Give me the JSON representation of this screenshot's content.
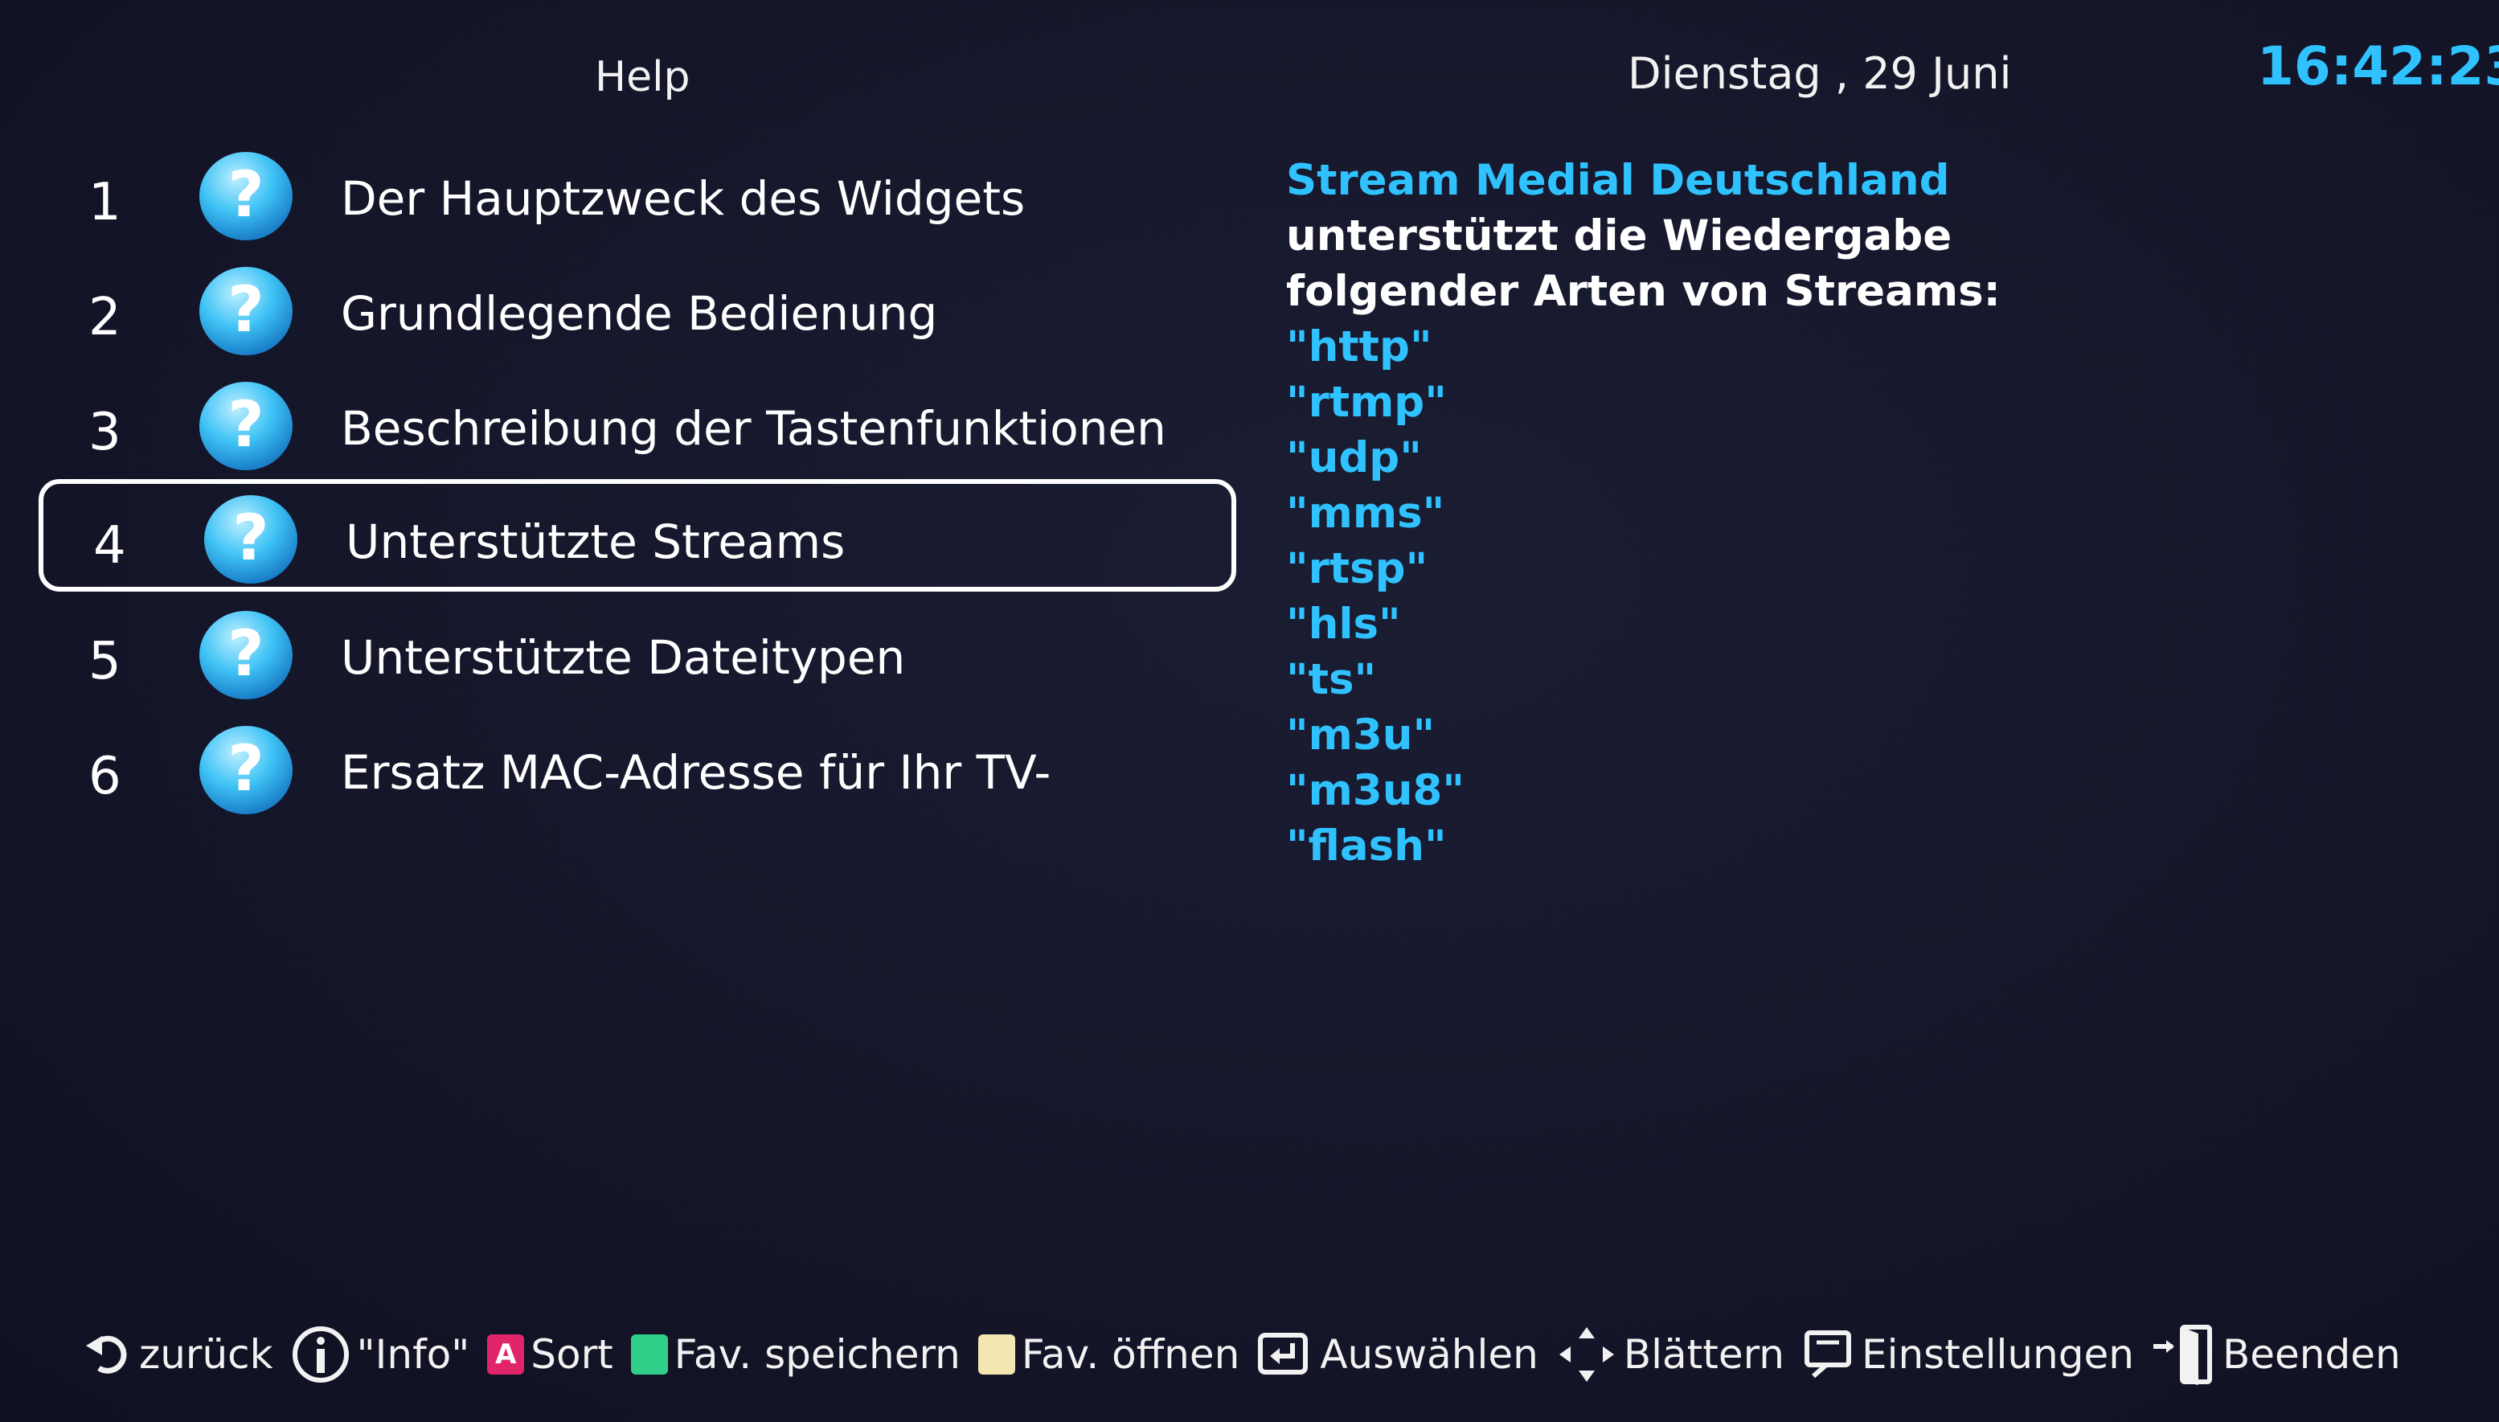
{
  "header": {
    "title": "Help",
    "date": "Dienstag , 29 Juni",
    "time": "16:42:23"
  },
  "menu": {
    "items": [
      {
        "number": "1",
        "label": "Der Hauptzweck des Widgets"
      },
      {
        "number": "2",
        "label": "Grundlegende Bedienung"
      },
      {
        "number": "3",
        "label": "Beschreibung der Tastenfunktionen"
      },
      {
        "number": "4",
        "label": "Unterstützte Streams"
      },
      {
        "number": "5",
        "label": "Unterstützte Dateitypen"
      },
      {
        "number": "6",
        "label": "Ersatz MAC-Adresse für Ihr TV-"
      }
    ],
    "selected_number": "4"
  },
  "description": {
    "title": "Stream Medial Deutschland",
    "line1": "unterstützt die Wiedergabe",
    "line2": "folgender Arten von Streams:",
    "streams": [
      "\"http\"",
      "\"rtmp\"",
      "\"udp\"",
      "\"mms\"",
      "\"rtsp\"",
      "\"hls\"",
      "\"ts\"",
      "\"m3u\"",
      "\"m3u8\"",
      "\"flash\""
    ]
  },
  "footer": {
    "back": "zurück",
    "info": "\"Info\"",
    "sort_badge": "A",
    "sort": "Sort",
    "fav_save": "Fav. speichern",
    "fav_open": "Fav. öffnen",
    "select": "Auswählen",
    "scroll": "Blättern",
    "settings": "Einstellungen",
    "exit": "Beenden"
  },
  "colors": {
    "background": "#15162a",
    "accent": "#2fc2ff",
    "text": "#ffffff",
    "badge_red": "#e2246b",
    "badge_green": "#2fcf8a",
    "badge_yellow": "#f4e6b0"
  },
  "icons": {
    "menu_item": "help-question-icon",
    "back": "back-arrow-icon",
    "info": "info-icon",
    "select": "enter-icon",
    "scroll": "navigation-arrows-icon",
    "settings": "settings-screen-icon",
    "exit": "exit-door-icon"
  }
}
